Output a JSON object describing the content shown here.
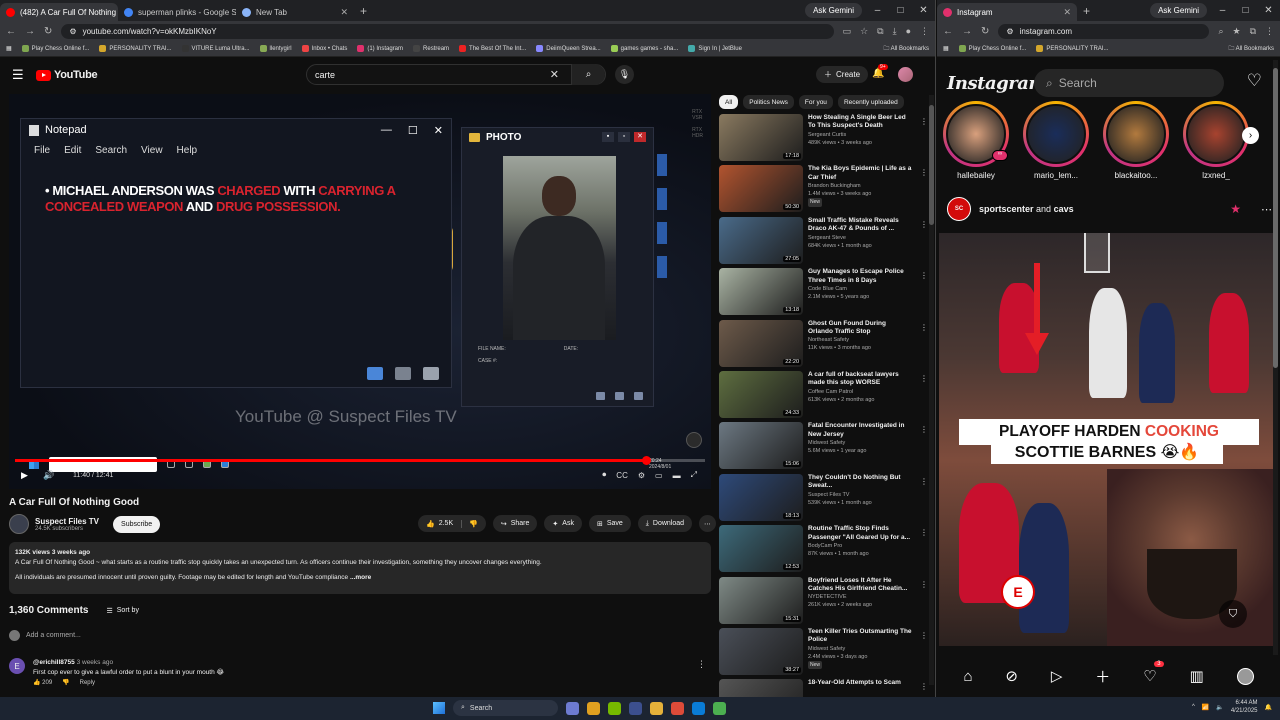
{
  "browser_left": {
    "tabs": [
      {
        "title": "(482) A Car Full Of Nothing Go",
        "color": "#ff0000",
        "active": true
      },
      {
        "title": "superman plinks - Google Sea",
        "color": "#4285f4",
        "active": false
      },
      {
        "title": "New Tab",
        "color": "#8ab4f8",
        "active": false
      }
    ],
    "gemini": "Ask Gemini",
    "url": "youtube.com/watch?v=okKMzbIKNoY",
    "bookmarks": [
      "Play Chess Online f...",
      "PERSONALITY TRAI...",
      "VITURE Luma Ultra...",
      "llentygirl",
      "Inbox • Chats",
      "(1) Instagram",
      "Restream",
      "The Best Of The Int...",
      "DeiimQueen Strea...",
      "games games - sha...",
      "Sign In | JetBlue"
    ],
    "all_bookmarks": "All Bookmarks"
  },
  "youtube": {
    "logo": "YouTube",
    "search_value": "carte",
    "create": "Create",
    "notif_count": "9+",
    "player": {
      "notepad_title": "Notepad",
      "notepad_menu": [
        "File",
        "Edit",
        "Search",
        "View",
        "Help"
      ],
      "text_parts": [
        {
          "t": "• MICHAEL ANDERSON WAS ",
          "c": "w"
        },
        {
          "t": "CHARGED",
          "c": "r"
        },
        {
          "t": " WITH ",
          "c": "w"
        },
        {
          "t": "CARRYING A CONCEALED WEAPON",
          "c": "r"
        },
        {
          "t": " AND ",
          "c": "w"
        },
        {
          "t": "DRUG POSSESSION.",
          "c": "r"
        }
      ],
      "photo_title": "PHOTO",
      "file_name": "FILE NAME:",
      "date": "DATE:",
      "case": "CASE #:",
      "watermark": "YouTube @ Suspect Files TV",
      "time": "11:40 / 12:41",
      "progress": 0.914,
      "corner": [
        "RTX",
        "VSR",
        "RTX",
        "HDR"
      ],
      "video_clock": "20:24",
      "video_date": "2024/8/01"
    },
    "video_title": "A Car Full Of Nothing Good",
    "channel": "Suspect Files TV",
    "subscribers": "24.5K subscribers",
    "subscribe": "Subscribe",
    "likes": "2.5K",
    "actions": [
      "Share",
      "Ask",
      "Save",
      "Download"
    ],
    "desc_meta": "132K views  3 weeks ago",
    "desc_line1": "A Car Full Of Nothing Good ~ what starts as a routine traffic stop quickly takes an unexpected turn. As officers continue their investigation, something they uncover changes everything.",
    "desc_line2": "All individuals are presumed innocent until proven guilty. Footage may be edited for length and YouTube compliance",
    "desc_more": "...more",
    "comments_count": "1,360 Comments",
    "sort_by": "Sort by",
    "add_comment": "Add a comment...",
    "comment": {
      "user": "@erichill8755",
      "age": "3 weeks ago",
      "text": "First cop ever to give a lawful order to put a blunt in your mouth 😂",
      "likes": "209",
      "reply": "Reply"
    },
    "chips": [
      "All",
      "Politics News",
      "For you",
      "Recently uploaded"
    ],
    "recommended": [
      {
        "title": "How Stealing A Single Beer Led To This Suspect's Death",
        "channel": "Sergeant Curtis",
        "meta": "489K views • 3 weeks ago",
        "dur": "17:18",
        "color": "#8a7a60",
        "new": false
      },
      {
        "title": "The Kia Boys Epidemic | Life as a Car Thief",
        "channel": "Brandon Buckingham",
        "meta": "1.4M views • 3 weeks ago",
        "dur": "50:30",
        "color": "#b2542f",
        "new": true
      },
      {
        "title": "Small Traffic Mistake Reveals Draco AK-47 & Pounds of ...",
        "channel": "Sergeant Steve",
        "meta": "684K views • 1 month ago",
        "dur": "27:05",
        "color": "#4a6b8a",
        "new": false
      },
      {
        "title": "Guy Manages to Escape Police Three Times in 8 Days",
        "channel": "Code Blue Cam",
        "meta": "2.1M views • 5 years ago",
        "dur": "13:18",
        "color": "#a9b3a3",
        "new": false
      },
      {
        "title": "Ghost Gun Found During Orlando Traffic Stop",
        "channel": "Northeast Safety",
        "meta": "11K views • 3 months ago",
        "dur": "22:20",
        "color": "#6d5a4a",
        "new": false
      },
      {
        "title": "A car full of backseat lawyers made this stop WORSE",
        "channel": "Coffee Cam Patrol",
        "meta": "613K views • 2 months ago",
        "dur": "24:33",
        "color": "#5e6e40",
        "new": false
      },
      {
        "title": "Fatal Encounter Investigated in New Jersey",
        "channel": "Midwest Safety",
        "meta": "5.6M views • 1 year ago",
        "dur": "15:06",
        "color": "#6c7882",
        "new": false
      },
      {
        "title": "They Couldn't Do Nothing But Sweat...",
        "channel": "Suspect Files TV",
        "meta": "539K views • 1 month ago",
        "dur": "18:13",
        "color": "#2e4a7a",
        "new": false
      },
      {
        "title": "Routine Traffic Stop Finds Passenger \"All Geared Up for a...",
        "channel": "BodyCam Pro",
        "meta": "87K views • 1 month ago",
        "dur": "12:53",
        "color": "#3d6a7a",
        "new": false
      },
      {
        "title": "Boyfriend Loses It After He Catches His Girlfriend Cheatin...",
        "channel": "NYDETECTIVE",
        "meta": "261K views • 2 weeks ago",
        "dur": "15:31",
        "color": "#7f8a86",
        "new": false
      },
      {
        "title": "Teen Killer Tries Outsmarting The Police",
        "channel": "Midwest Safety",
        "meta": "2.4M views • 3 days ago",
        "dur": "38:27",
        "color": "#4a4f58",
        "new": true
      },
      {
        "title": "18-Year-Old Attempts to Scam",
        "channel": "",
        "meta": "",
        "dur": "",
        "color": "#555",
        "new": false
      }
    ]
  },
  "browser_right": {
    "tab": "Instagram",
    "gemini": "Ask Gemini",
    "url": "instagram.com",
    "bookmarks": [
      "Play Chess Online f...",
      "PERSONALITY TRAI..."
    ],
    "all_bookmarks": "All Bookmarks"
  },
  "instagram": {
    "logo": "Instagram",
    "search_placeholder": "Search",
    "stories": [
      {
        "name": "hallebailey",
        "color": "#d9a07d"
      },
      {
        "name": "mario_lem...",
        "color": "#1a2d5a"
      },
      {
        "name": "blackaitoo...",
        "color": "#b27a3e"
      },
      {
        "name": "lzxned_",
        "color": "#a8432f"
      }
    ],
    "post_user": "sportscenter",
    "post_and": "and",
    "post_collab": "cavs",
    "caption_1a": "PLAYOFF HARDEN",
    "caption_1b": "COOKING",
    "caption_2": "SCOTTIE BARNES 😭🔥",
    "notif_badge": "3",
    "filter_badge": "2"
  },
  "taskbar": {
    "search": "Search",
    "time": "6:44 AM",
    "date": "4/21/2025"
  }
}
